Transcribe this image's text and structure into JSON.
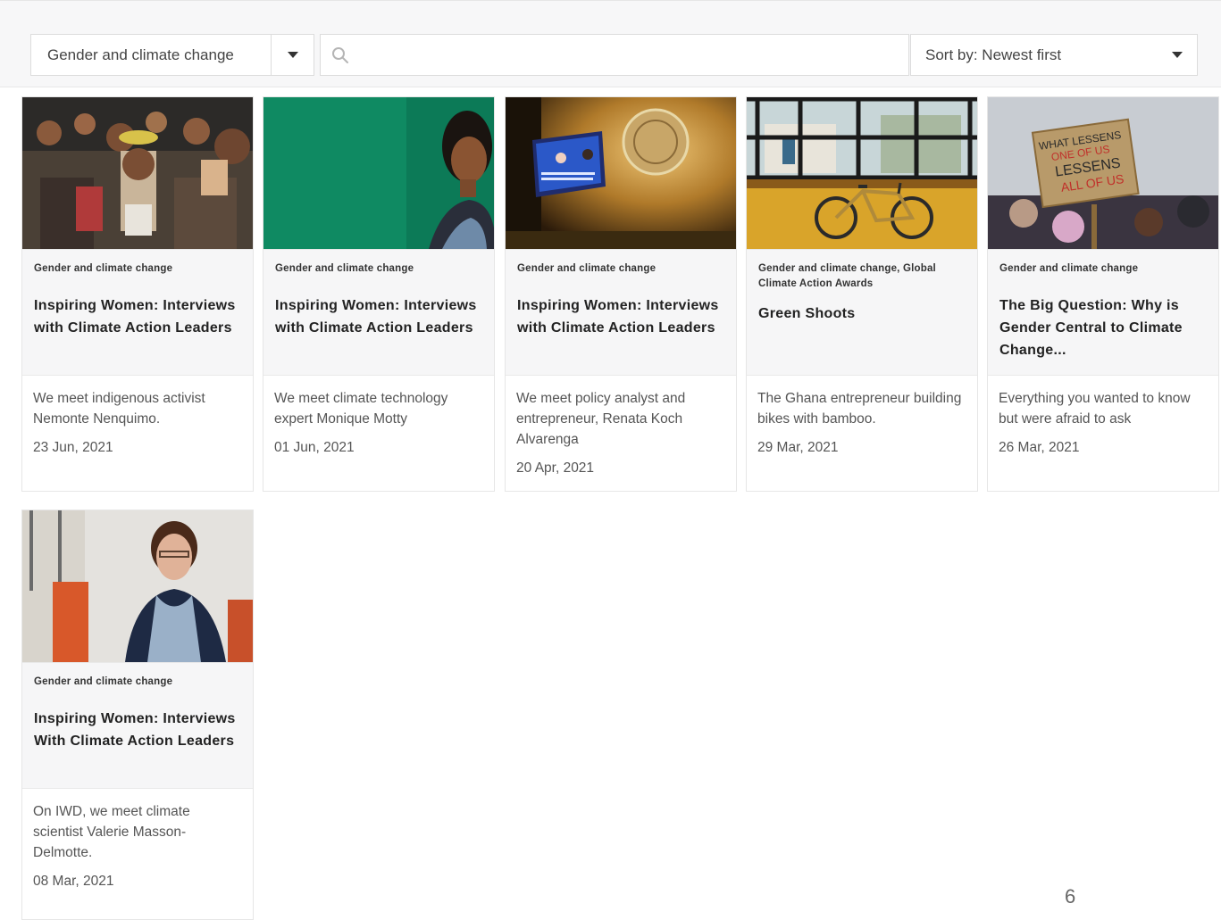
{
  "filters": {
    "category_value": "Gender and climate change",
    "search_placeholder": "",
    "sort_value": "Sort by: Newest first"
  },
  "cards": [
    {
      "tag": "Gender and climate change",
      "title": "Inspiring Women: Interviews with Climate Action Leaders",
      "description": "We meet indigenous activist Nemonte Nenquimo.",
      "date": "23 Jun, 2021",
      "image": "indigenous-crowd-photo"
    },
    {
      "tag": "Gender and climate change",
      "title": "Inspiring Women: Interviews with Climate Action Leaders",
      "description": "We meet climate technology expert Monique Motty",
      "date": "01 Jun, 2021",
      "image": "woman-green-background-photo"
    },
    {
      "tag": "Gender and climate change",
      "title": "Inspiring Women: Interviews with Climate Action Leaders",
      "description": "We meet policy analyst and entrepreneur, Renata Koch Alvarenga",
      "date": "20 Apr, 2021",
      "image": "un-assembly-screen-photo"
    },
    {
      "tag": "Gender and climate change, Global Climate Action Awards",
      "title": "Green Shoots",
      "description": "The Ghana entrepreneur building bikes with bamboo.",
      "date": "29 Mar, 2021",
      "image": "bamboo-bike-photo"
    },
    {
      "tag": "Gender and climate change",
      "title": "The Big Question: Why is Gender Central to Climate Change...",
      "description": "Everything you wanted to know but were afraid to ask",
      "date": "26 Mar, 2021",
      "image": "protest-sign-photo",
      "sign_text": [
        "WHAT LESSENS",
        "ONE OF US",
        "LESSENS",
        "ALL OF US"
      ]
    },
    {
      "tag": "Gender and climate change",
      "title": "Inspiring Women: Interviews With Climate Action Leaders",
      "description": "On IWD, we meet climate scientist Valerie Masson-Delmotte.",
      "date": "08 Mar, 2021",
      "image": "scientist-portrait-photo"
    }
  ],
  "pagination": {
    "current_page": "6"
  },
  "colors": {
    "filter_bar_bg": "#f7f7f8",
    "card_header_bg": "#f6f6f7",
    "border": "#e6e6e6"
  }
}
